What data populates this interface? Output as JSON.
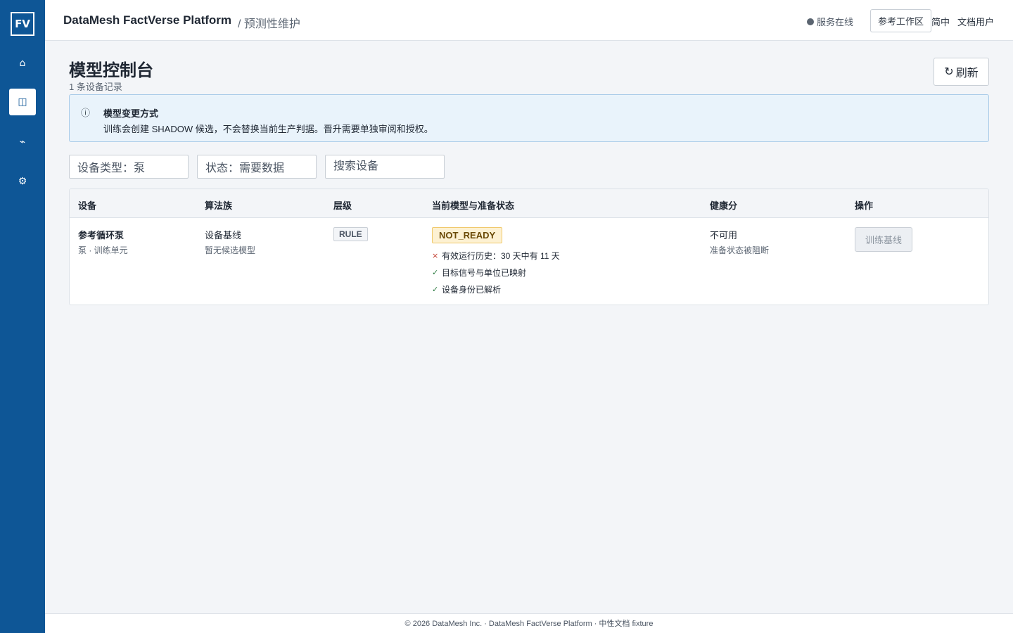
{
  "sidebar": {
    "logo": "FV",
    "items": [
      {
        "icon": "home-icon",
        "glyph": "⌂"
      },
      {
        "icon": "model-console-icon",
        "glyph": "◫"
      },
      {
        "icon": "signal-icon",
        "glyph": "⌁"
      },
      {
        "icon": "settings-icon",
        "glyph": "⚙"
      }
    ]
  },
  "header": {
    "title": "DataMesh FactVerse Platform",
    "breadcrumb": "/ 预测性维护",
    "status": "服务在线",
    "workspace_button": "参考工作区",
    "language": "简中",
    "user": "文档用户"
  },
  "page": {
    "title": "模型控制台",
    "subtitle": "1 条设备记录",
    "refresh_icon": "↻",
    "refresh_label": "刷新"
  },
  "notice": {
    "icon": "ⓘ",
    "title": "模型变更方式",
    "body": "训练会创建 SHADOW 候选，不会替换当前生产判据。晋升需要单独审阅和授权。"
  },
  "filters": {
    "device_type": "设备类型：泵",
    "status": "状态：需要数据",
    "search_placeholder": "搜索设备"
  },
  "table": {
    "headers": [
      "设备",
      "算法族",
      "层级",
      "当前模型与准备状态",
      "健康分",
      "操作"
    ],
    "rows": [
      {
        "device_name": "参考循环泵",
        "device_sub": "泵 · 训练单元",
        "algo": "设备基线",
        "algo_sub": "暂无候选模型",
        "tier": "RULE",
        "status": "NOT_READY",
        "checks": [
          {
            "mark": "×",
            "ok": false,
            "text": "有效运行历史：30 天中有 11 天"
          },
          {
            "mark": "✓",
            "ok": true,
            "text": "目标信号与单位已映射"
          },
          {
            "mark": "✓",
            "ok": true,
            "text": "设备身份已解析"
          }
        ],
        "health": "不可用",
        "health_sub": "准备状态被阻断",
        "action": "训练基线"
      }
    ]
  },
  "footer": "© 2026 DataMesh Inc. · DataMesh FactVerse Platform · 中性文档 fixture",
  "colors": {
    "sidebar": "#0e5696",
    "notice_bg": "#e9f3fb",
    "badge_warning": "#fdf1d2"
  }
}
